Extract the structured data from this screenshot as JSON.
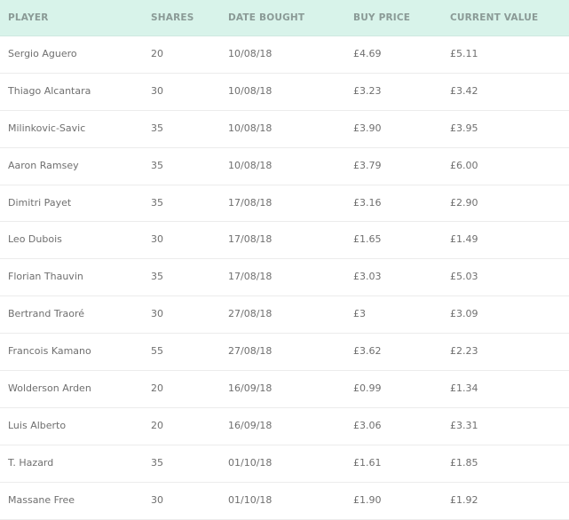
{
  "headers": {
    "player": "PLAYER",
    "shares": "SHARES",
    "date": "DATE BOUGHT",
    "buy": "BUY PRICE",
    "current": "CURRENT VALUE"
  },
  "rows": [
    {
      "player": "Sergio Aguero",
      "shares": "20",
      "date": "10/08/18",
      "buy": "£4.69",
      "current": "£5.11"
    },
    {
      "player": "Thiago Alcantara",
      "shares": "30",
      "date": "10/08/18",
      "buy": "£3.23",
      "current": "£3.42"
    },
    {
      "player": "Milinkovic-Savic",
      "shares": "35",
      "date": "10/08/18",
      "buy": "£3.90",
      "current": "£3.95"
    },
    {
      "player": "Aaron Ramsey",
      "shares": "35",
      "date": "10/08/18",
      "buy": "£3.79",
      "current": "£6.00"
    },
    {
      "player": "Dimitri Payet",
      "shares": "35",
      "date": "17/08/18",
      "buy": "£3.16",
      "current": "£2.90"
    },
    {
      "player": "Leo Dubois",
      "shares": "30",
      "date": "17/08/18",
      "buy": "£1.65",
      "current": "£1.49"
    },
    {
      "player": "Florian Thauvin",
      "shares": "35",
      "date": "17/08/18",
      "buy": "£3.03",
      "current": "£5.03"
    },
    {
      "player": "Bertrand Traoré",
      "shares": "30",
      "date": "27/08/18",
      "buy": "£3",
      "current": "£3.09"
    },
    {
      "player": "Francois Kamano",
      "shares": "55",
      "date": "27/08/18",
      "buy": "£3.62",
      "current": "£2.23"
    },
    {
      "player": "Wolderson Arden",
      "shares": "20",
      "date": "16/09/18",
      "buy": "£0.99",
      "current": "£1.34"
    },
    {
      "player": "Luis Alberto",
      "shares": "20",
      "date": "16/09/18",
      "buy": "£3.06",
      "current": "£3.31"
    },
    {
      "player": "T. Hazard",
      "shares": "35",
      "date": "01/10/18",
      "buy": "£1.61",
      "current": "£1.85"
    },
    {
      "player": "Massane Free",
      "shares": "30",
      "date": "01/10/18",
      "buy": "£1.90",
      "current": "£1.92"
    }
  ]
}
